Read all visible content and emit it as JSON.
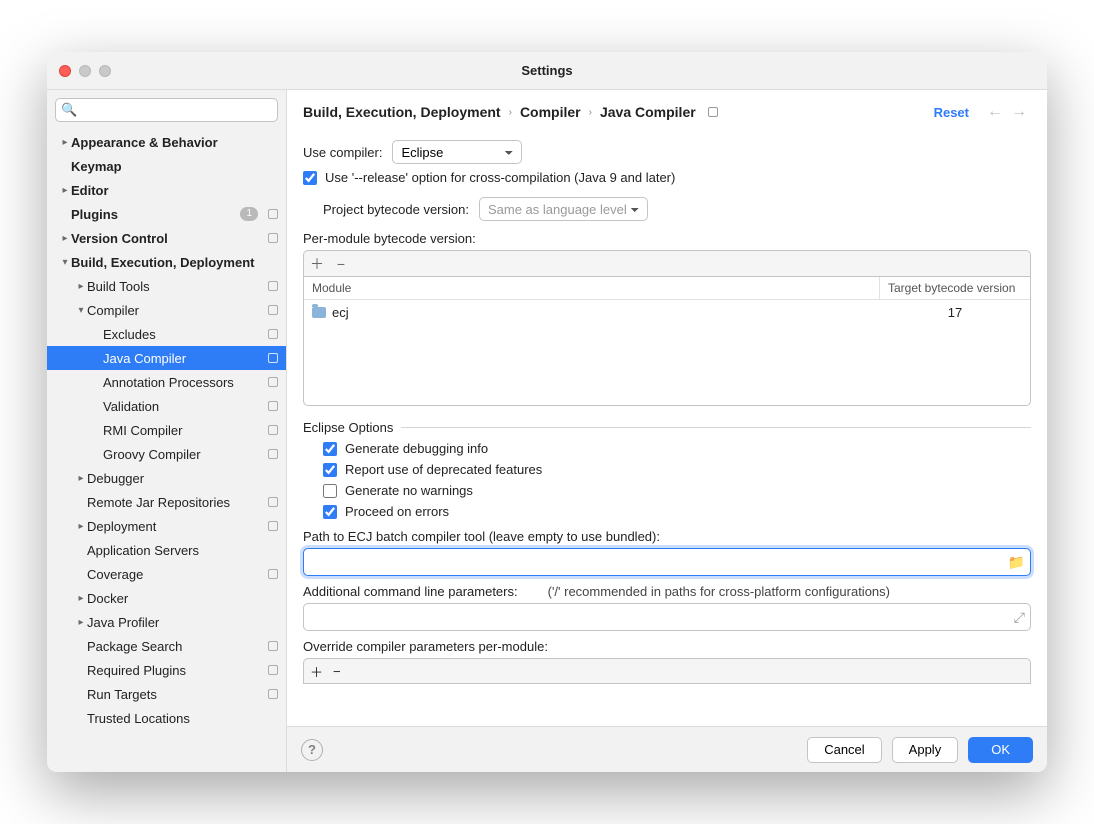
{
  "window": {
    "title": "Settings"
  },
  "search": {
    "placeholder": ""
  },
  "sidebar": {
    "items": [
      {
        "label": "Appearance & Behavior",
        "level": 0,
        "chev": "right",
        "bold": true
      },
      {
        "label": "Keymap",
        "level": 0,
        "chev": "none",
        "bold": true
      },
      {
        "label": "Editor",
        "level": 0,
        "chev": "right",
        "bold": true
      },
      {
        "label": "Plugins",
        "level": 0,
        "chev": "none",
        "bold": true,
        "count": "1",
        "box": true
      },
      {
        "label": "Version Control",
        "level": 0,
        "chev": "right",
        "bold": true,
        "box": true
      },
      {
        "label": "Build, Execution, Deployment",
        "level": 0,
        "chev": "down",
        "bold": true
      },
      {
        "label": "Build Tools",
        "level": 1,
        "chev": "right",
        "box": true
      },
      {
        "label": "Compiler",
        "level": 1,
        "chev": "down",
        "box": true
      },
      {
        "label": "Excludes",
        "level": 2,
        "chev": "none",
        "box": true
      },
      {
        "label": "Java Compiler",
        "level": 2,
        "chev": "none",
        "box": true,
        "selected": true
      },
      {
        "label": "Annotation Processors",
        "level": 2,
        "chev": "none",
        "box": true
      },
      {
        "label": "Validation",
        "level": 2,
        "chev": "none",
        "box": true
      },
      {
        "label": "RMI Compiler",
        "level": 2,
        "chev": "none",
        "box": true
      },
      {
        "label": "Groovy Compiler",
        "level": 2,
        "chev": "none",
        "box": true
      },
      {
        "label": "Debugger",
        "level": 1,
        "chev": "right"
      },
      {
        "label": "Remote Jar Repositories",
        "level": 1,
        "chev": "none",
        "box": true
      },
      {
        "label": "Deployment",
        "level": 1,
        "chev": "right",
        "box": true
      },
      {
        "label": "Application Servers",
        "level": 1,
        "chev": "none"
      },
      {
        "label": "Coverage",
        "level": 1,
        "chev": "none",
        "box": true
      },
      {
        "label": "Docker",
        "level": 1,
        "chev": "right"
      },
      {
        "label": "Java Profiler",
        "level": 1,
        "chev": "right"
      },
      {
        "label": "Package Search",
        "level": 1,
        "chev": "none",
        "box": true
      },
      {
        "label": "Required Plugins",
        "level": 1,
        "chev": "none",
        "box": true
      },
      {
        "label": "Run Targets",
        "level": 1,
        "chev": "none",
        "box": true
      },
      {
        "label": "Trusted Locations",
        "level": 1,
        "chev": "none"
      }
    ]
  },
  "breadcrumb": {
    "p0": "Build, Execution, Deployment",
    "p1": "Compiler",
    "p2": "Java Compiler"
  },
  "actions": {
    "reset": "Reset"
  },
  "form": {
    "use_compiler_lbl": "Use compiler:",
    "use_compiler_val": "Eclipse",
    "release_opt": "Use '--release' option for cross-compilation (Java 9 and later)",
    "proj_bc_lbl": "Project bytecode version:",
    "proj_bc_val": "Same as language level",
    "per_module_lbl": "Per-module bytecode version:",
    "th_module": "Module",
    "th_target": "Target bytecode version",
    "row_module": "ecj",
    "row_target": "17",
    "eclipse_opts": "Eclipse Options",
    "gen_debug": "Generate debugging info",
    "deprecated": "Report use of deprecated features",
    "no_warn": "Generate no warnings",
    "proceed": "Proceed on errors",
    "ecj_path_lbl": "Path to ECJ batch compiler tool (leave empty to use bundled):",
    "add_params_lbl": "Additional command line parameters:",
    "add_params_hint": "('/' recommended in paths for cross-platform configurations)",
    "override_lbl": "Override compiler parameters per-module:"
  },
  "footer": {
    "cancel": "Cancel",
    "apply": "Apply",
    "ok": "OK"
  }
}
